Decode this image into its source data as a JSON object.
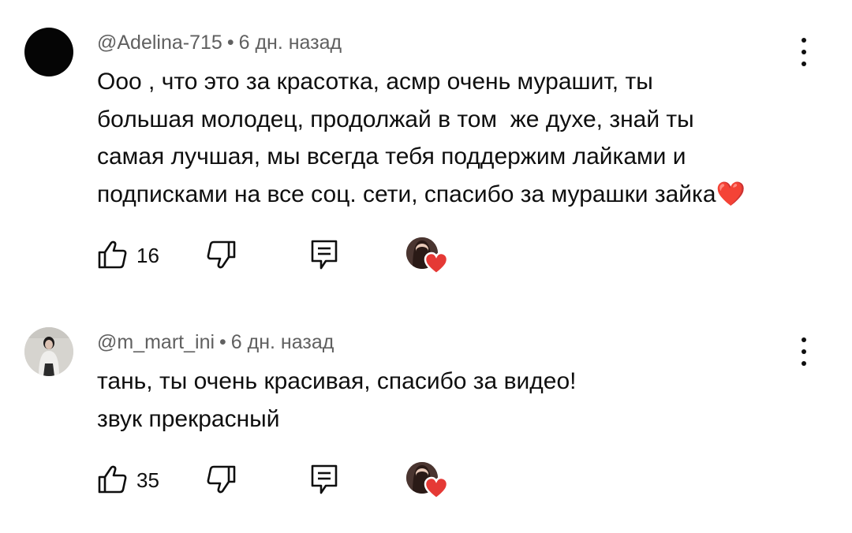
{
  "comments": [
    {
      "author": "@Adelina-715",
      "separator": "•",
      "time": "6 дн. назад",
      "lines": [
        "Ооо , что это за красотка, асмр очень мурашит, ты",
        "большая молодец, продолжай в том  же духе, знай ты",
        "самая лучшая, мы всегда тебя поддержим лайками и",
        "подписками на все соц. сети, спасибо за мурашки зайка❤️"
      ],
      "likes": "16",
      "avatar_icon": "black-circle-avatar",
      "creator_heart": true
    },
    {
      "author": "@m_mart_ini",
      "separator": "•",
      "time": "6 дн. назад",
      "lines": [
        "тань, ты очень красивая, спасибо за видео!",
        "звук прекрасный"
      ],
      "likes": "35",
      "avatar_icon": "photo-avatar-person",
      "creator_heart": true
    }
  ],
  "icons": {
    "like": "thumbs-up-icon",
    "dislike": "thumbs-down-icon",
    "reply": "reply-comment-icon",
    "menu": "vertical-dots-menu-icon",
    "heart": "heart-icon"
  },
  "colors": {
    "text": "#0f0f0f",
    "meta": "#606060",
    "heart": "#e53935",
    "background": "#ffffff"
  }
}
